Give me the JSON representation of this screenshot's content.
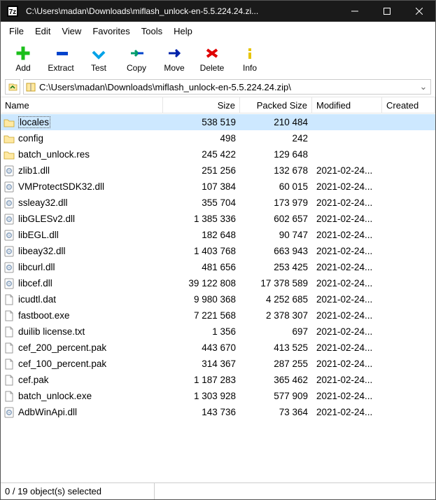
{
  "titlebar": {
    "title": "C:\\Users\\madan\\Downloads\\miflash_unlock-en-5.5.224.24.zi..."
  },
  "menubar": {
    "items": [
      "File",
      "Edit",
      "View",
      "Favorites",
      "Tools",
      "Help"
    ]
  },
  "toolbar": {
    "items": [
      {
        "label": "Add",
        "name": "add"
      },
      {
        "label": "Extract",
        "name": "extract"
      },
      {
        "label": "Test",
        "name": "test"
      },
      {
        "label": "Copy",
        "name": "copy"
      },
      {
        "label": "Move",
        "name": "move"
      },
      {
        "label": "Delete",
        "name": "delete"
      },
      {
        "label": "Info",
        "name": "info"
      }
    ]
  },
  "addressbar": {
    "path": "C:\\Users\\madan\\Downloads\\miflash_unlock-en-5.5.224.24.zip\\"
  },
  "columns": {
    "name": "Name",
    "size": "Size",
    "packed": "Packed Size",
    "modified": "Modified",
    "created": "Created"
  },
  "files": [
    {
      "name": "locales",
      "size": "538 519",
      "packed": "210 484",
      "modified": "",
      "icon": "folder",
      "selected": true
    },
    {
      "name": "config",
      "size": "498",
      "packed": "242",
      "modified": "",
      "icon": "folder"
    },
    {
      "name": "batch_unlock.res",
      "size": "245 422",
      "packed": "129 648",
      "modified": "",
      "icon": "folder"
    },
    {
      "name": "zlib1.dll",
      "size": "251 256",
      "packed": "132 678",
      "modified": "2021-02-24...",
      "icon": "dll"
    },
    {
      "name": "VMProtectSDK32.dll",
      "size": "107 384",
      "packed": "60 015",
      "modified": "2021-02-24...",
      "icon": "dll"
    },
    {
      "name": "ssleay32.dll",
      "size": "355 704",
      "packed": "173 979",
      "modified": "2021-02-24...",
      "icon": "dll"
    },
    {
      "name": "libGLESv2.dll",
      "size": "1 385 336",
      "packed": "602 657",
      "modified": "2021-02-24...",
      "icon": "dll"
    },
    {
      "name": "libEGL.dll",
      "size": "182 648",
      "packed": "90 747",
      "modified": "2021-02-24...",
      "icon": "dll"
    },
    {
      "name": "libeay32.dll",
      "size": "1 403 768",
      "packed": "663 943",
      "modified": "2021-02-24...",
      "icon": "dll"
    },
    {
      "name": "libcurl.dll",
      "size": "481 656",
      "packed": "253 425",
      "modified": "2021-02-24...",
      "icon": "dll"
    },
    {
      "name": "libcef.dll",
      "size": "39 122 808",
      "packed": "17 378 589",
      "modified": "2021-02-24...",
      "icon": "dll"
    },
    {
      "name": "icudtl.dat",
      "size": "9 980 368",
      "packed": "4 252 685",
      "modified": "2021-02-24...",
      "icon": "file"
    },
    {
      "name": "fastboot.exe",
      "size": "7 221 568",
      "packed": "2 378 307",
      "modified": "2021-02-24...",
      "icon": "file"
    },
    {
      "name": "duilib license.txt",
      "size": "1 356",
      "packed": "697",
      "modified": "2021-02-24...",
      "icon": "file"
    },
    {
      "name": "cef_200_percent.pak",
      "size": "443 670",
      "packed": "413 525",
      "modified": "2021-02-24...",
      "icon": "file"
    },
    {
      "name": "cef_100_percent.pak",
      "size": "314 367",
      "packed": "287 255",
      "modified": "2021-02-24...",
      "icon": "file"
    },
    {
      "name": "cef.pak",
      "size": "1 187 283",
      "packed": "365 462",
      "modified": "2021-02-24...",
      "icon": "file"
    },
    {
      "name": "batch_unlock.exe",
      "size": "1 303 928",
      "packed": "577 909",
      "modified": "2021-02-24...",
      "icon": "file"
    },
    {
      "name": "AdbWinApi.dll",
      "size": "143 736",
      "packed": "73 364",
      "modified": "2021-02-24...",
      "icon": "dll"
    }
  ],
  "statusbar": {
    "selection": "0 / 19 object(s) selected"
  }
}
